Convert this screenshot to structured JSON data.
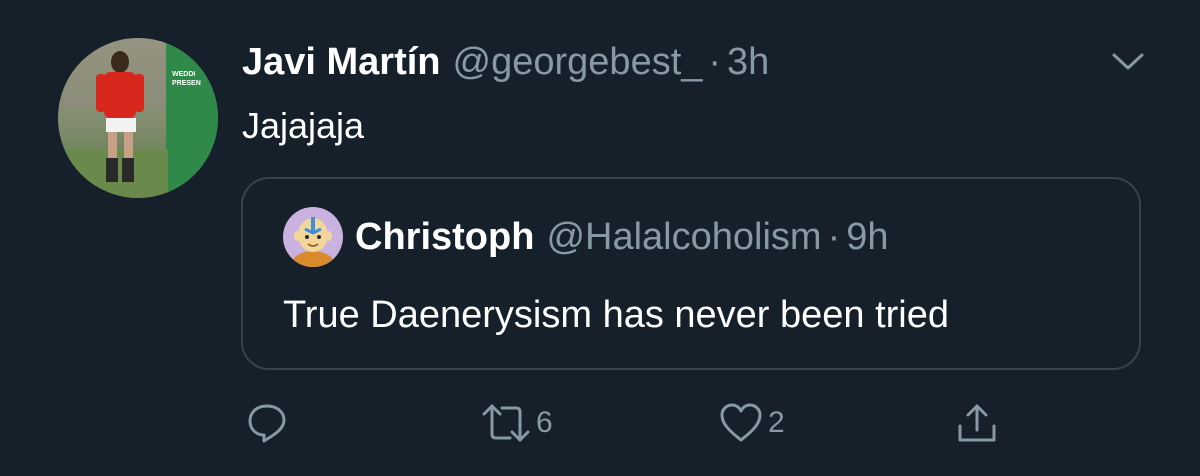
{
  "tweet": {
    "author_name": "Javi Martín",
    "author_handle": "@georgebest_",
    "separator": "·",
    "timestamp": "3h",
    "text": "Jajajaja",
    "avatar_sign_text": "WEDDI PRESEN"
  },
  "quoted_tweet": {
    "author_name": "Christoph",
    "author_handle": "@Halalcoholism",
    "separator": "·",
    "timestamp": "9h",
    "text": "True Daenerysism has never been tried"
  },
  "actions": {
    "reply_count": "",
    "retweet_count": "6",
    "like_count": "2"
  },
  "icons": {
    "reply": "reply-icon",
    "retweet": "retweet-icon",
    "like": "heart-icon",
    "share": "share-icon",
    "menu": "chevron-down-icon"
  },
  "colors": {
    "background": "#15202b",
    "secondary_text": "#8899a6",
    "border": "#38444d",
    "primary_text": "#ffffff"
  }
}
